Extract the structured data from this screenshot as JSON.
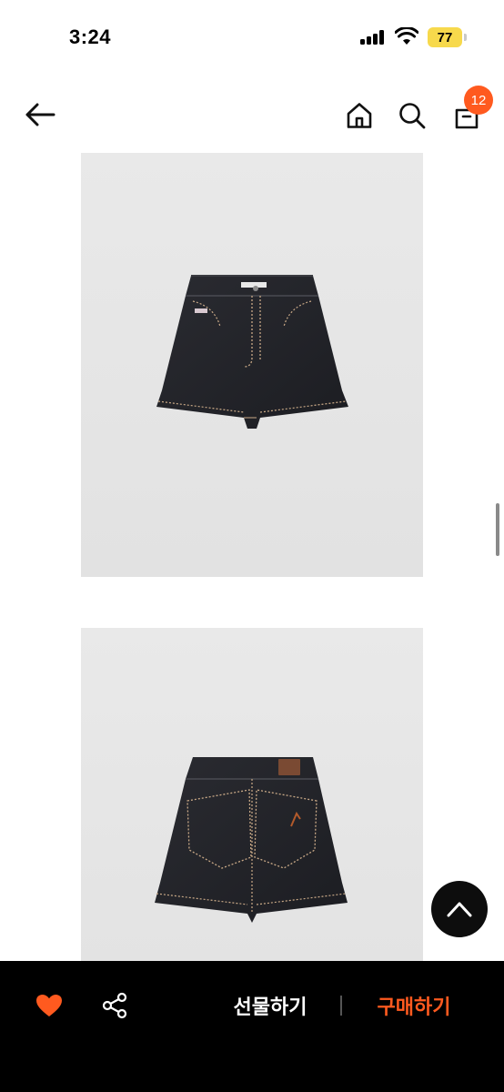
{
  "status_bar": {
    "time": "3:24",
    "battery_level": "77",
    "battery_color": "#f7d94c"
  },
  "header": {
    "back_icon": "arrow-left-icon",
    "home_icon": "home-icon",
    "search_icon": "search-icon",
    "bag_icon": "shopping-bag-icon",
    "cart_count": "12",
    "badge_color": "#ff5a1f"
  },
  "product_images": [
    {
      "view": "front",
      "color": "#23242a"
    },
    {
      "view": "back",
      "color": "#23242a"
    }
  ],
  "scroll_top": {
    "icon": "chevron-up-icon"
  },
  "bottom_bar": {
    "like_icon": "heart-icon",
    "like_color": "#ff5a1f",
    "share_icon": "share-icon",
    "gift_label": "선물하기",
    "buy_label": "구매하기",
    "accent_color": "#ff5a1f"
  }
}
